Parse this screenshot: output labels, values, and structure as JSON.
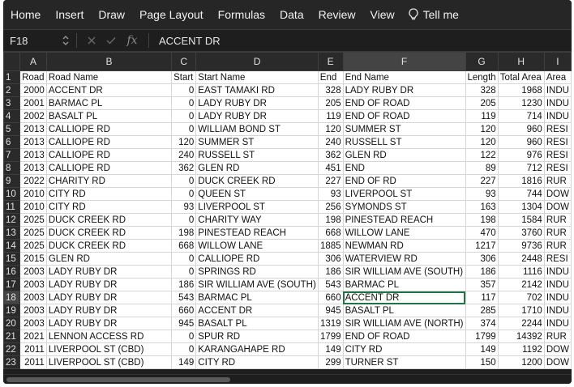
{
  "ribbon": {
    "items": [
      "Home",
      "Insert",
      "Draw",
      "Page Layout",
      "Formulas",
      "Data",
      "Review",
      "View"
    ],
    "tell_me": "Tell me"
  },
  "formula_bar": {
    "name_box": "F18",
    "fx_label": "fx",
    "value": "ACCENT DR"
  },
  "grid": {
    "selected_cell": "F18",
    "columns": [
      "A",
      "B",
      "C",
      "D",
      "E",
      "F",
      "G",
      "H",
      "I"
    ],
    "header_row": [
      "Road",
      "Road Name",
      "Start",
      "Start Name",
      "End",
      "End Name",
      "Length",
      "Total Area",
      "Area"
    ],
    "rows": [
      [
        "2000",
        "ACCENT DR",
        "0",
        "EAST TAMAKI RD",
        "328",
        "LADY RUBY DR",
        "328",
        "1968",
        "INDU"
      ],
      [
        "2001",
        "BARMAC PL",
        "0",
        "LADY RUBY DR",
        "205",
        "END OF ROAD",
        "205",
        "1230",
        "INDU"
      ],
      [
        "2002",
        "BASALT PL",
        "0",
        "LADY RUBY DR",
        "119",
        "END OF ROAD",
        "119",
        "714",
        "INDU"
      ],
      [
        "2013",
        "CALLIOPE RD",
        "0",
        "WILLIAM BOND ST",
        "120",
        "SUMMER ST",
        "120",
        "960",
        "RESI"
      ],
      [
        "2013",
        "CALLIOPE RD",
        "120",
        "SUMMER ST",
        "240",
        "RUSSELL ST",
        "120",
        "960",
        "RESI"
      ],
      [
        "2013",
        "CALLIOPE RD",
        "240",
        "RUSSELL ST",
        "362",
        "GLEN RD",
        "122",
        "976",
        "RESI"
      ],
      [
        "2013",
        "CALLIOPE RD",
        "362",
        "GLEN RD",
        "451",
        "END",
        "89",
        "712",
        "RESI"
      ],
      [
        "2022",
        "CHARITY RD",
        "0",
        "DUCK CREEK RD",
        "227",
        "END OF RD",
        "227",
        "1816",
        "RUR"
      ],
      [
        "2010",
        "CITY RD",
        "0",
        "QUEEN ST",
        "93",
        "LIVERPOOL ST",
        "93",
        "744",
        "DOW"
      ],
      [
        "2010",
        "CITY RD",
        "93",
        "LIVERPOOL ST",
        "256",
        "SYMONDS ST",
        "163",
        "1304",
        "DOW"
      ],
      [
        "2025",
        "DUCK CREEK RD",
        "0",
        "CHARITY WAY",
        "198",
        "PINESTEAD REACH",
        "198",
        "1584",
        "RUR"
      ],
      [
        "2025",
        "DUCK CREEK RD",
        "198",
        "PINESTEAD REACH",
        "668",
        "WILLOW LANE",
        "470",
        "3760",
        "RUR"
      ],
      [
        "2025",
        "DUCK CREEK RD",
        "668",
        "WILLOW LANE",
        "1885",
        "NEWMAN RD",
        "1217",
        "9736",
        "RUR"
      ],
      [
        "2015",
        "GLEN RD",
        "0",
        "CALLIOPE RD",
        "306",
        "WATERVIEW RD",
        "306",
        "2448",
        "RESI"
      ],
      [
        "2003",
        "LADY RUBY DR",
        "0",
        "SPRINGS RD",
        "186",
        "SIR WILLIAM AVE (SOUTH)",
        "186",
        "1116",
        "INDU"
      ],
      [
        "2003",
        "LADY RUBY DR",
        "186",
        "SIR WILLIAM AVE (SOUTH)",
        "543",
        "BARMAC PL",
        "357",
        "2142",
        "INDU"
      ],
      [
        "2003",
        "LADY RUBY DR",
        "543",
        "BARMAC PL",
        "660",
        "ACCENT DR",
        "117",
        "702",
        "INDU"
      ],
      [
        "2003",
        "LADY RUBY DR",
        "660",
        "ACCENT DR",
        "945",
        "BASALT PL",
        "285",
        "1710",
        "INDU"
      ],
      [
        "2003",
        "LADY RUBY DR",
        "945",
        "BASALT PL",
        "1319",
        "SIR WILLIAM AVE (NORTH)",
        "374",
        "2244",
        "INDU"
      ],
      [
        "2021",
        "LENNON ACCESS RD",
        "0",
        "SPUR RD",
        "1799",
        "END OF ROAD",
        "1799",
        "14392",
        "RUR"
      ],
      [
        "2011",
        "LIVERPOOL ST (CBD)",
        "0",
        "KARANGAHAPE RD",
        "149",
        "CITY RD",
        "149",
        "1192",
        "DOW"
      ],
      [
        "2011",
        "LIVERPOOL ST (CBD)",
        "149",
        "CITY RD",
        "299",
        "TURNER ST",
        "150",
        "1200",
        "DOW"
      ]
    ]
  }
}
